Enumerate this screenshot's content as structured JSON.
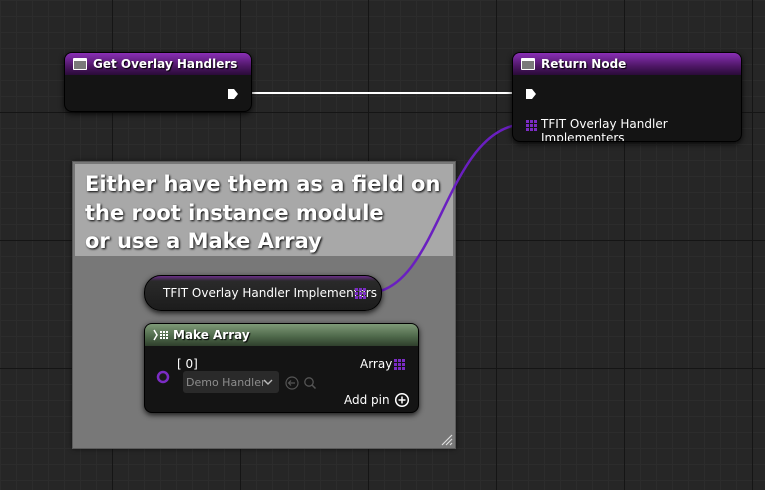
{
  "nodes": {
    "get_overlay_handlers": {
      "title": "Get Overlay Handlers"
    },
    "return_node": {
      "title": "Return Node",
      "output_label": "TFIT Overlay Handler Implementers"
    },
    "variable_node": {
      "label": "TFIT Overlay Handler Implementers"
    },
    "make_array": {
      "title": "Make Array",
      "index_label": "[ 0]",
      "dropdown_value": "Demo Handler",
      "output_label": "Array",
      "add_pin_label": "Add pin"
    }
  },
  "comment": {
    "line1": "Either have them as a field on",
    "line2": "the root instance module",
    "line3": "or use a Make Array"
  },
  "colors": {
    "purple_pin": "#7b2cc4",
    "exec_wire": "#ffffff",
    "canvas": "#262626"
  },
  "icons": [
    "function-icon",
    "exec-pin-icon",
    "array-grid-icon",
    "make-array-icon",
    "chevron-down-icon",
    "back-arrow-icon",
    "search-icon",
    "add-circle-icon",
    "resize-handle-icon"
  ]
}
